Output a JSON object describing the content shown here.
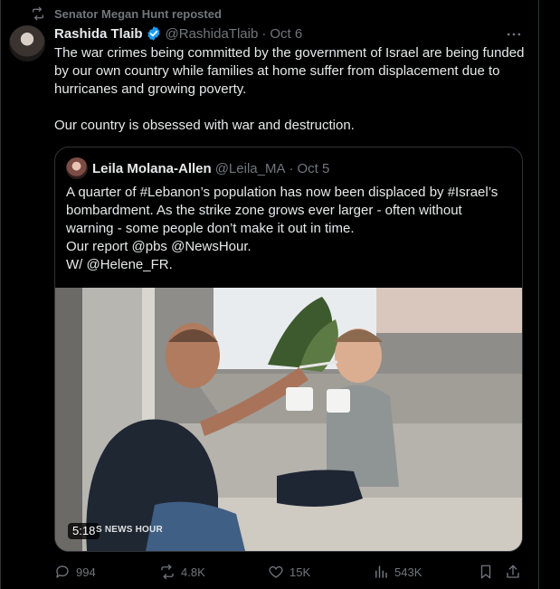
{
  "repost_context": {
    "text": "Senator Megan Hunt reposted",
    "icon": "repost-icon"
  },
  "tweet": {
    "author_name": "Rashida Tlaib",
    "handle": "@RashidaTlaib",
    "separator": "·",
    "date": "Oct 6",
    "paragraphs": [
      "The war crimes being committed by the government of Israel are being funded by our own country while families at home suffer from displacement due to hurricanes and growing poverty.",
      "Our country is obsessed with war and destruction."
    ]
  },
  "quote": {
    "author_name": "Leila Molana-Allen",
    "handle": "@Leila_MA",
    "separator": "·",
    "date": "Oct 5",
    "lines": [
      "A quarter of #Lebanon’s population has now been displaced by #Israel’s bombardment. As the strike zone grows ever larger - often without warning - some people don’t make it out in time.",
      "Our report @pbs @NewsHour.",
      "W/ @Helene_FR."
    ],
    "video": {
      "duration": "5:18",
      "watermark": "S NEWS HOUR"
    }
  },
  "actions": {
    "replies": "994",
    "reposts": "4.8K",
    "likes": "15K",
    "views": "543K"
  },
  "colors": {
    "background": "#000000",
    "text": "#e7e9ea",
    "muted": "#71767b",
    "verified": "#1d9bf0",
    "border": "#2f3336"
  }
}
